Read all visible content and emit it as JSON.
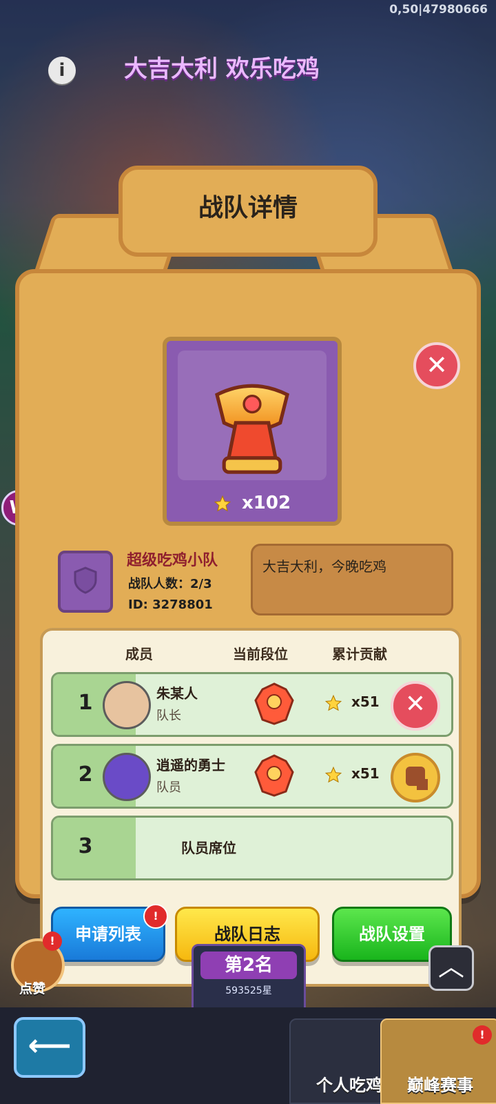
{
  "top_right_info": "0,50|47980666",
  "event_banner_title": "大吉大利 欢乐吃鸡",
  "modal": {
    "title": "战队详情",
    "banner_star_count": "x102",
    "team": {
      "name": "超级吃鸡小队",
      "count_label": "战队人数：2/3",
      "id_label": "ID: 3278801",
      "motto": "大吉大利，今晚吃鸡"
    },
    "table": {
      "headers": [
        "成员",
        "当前段位",
        "累计贡献"
      ],
      "rows": [
        {
          "index": "1",
          "name": "朱某人",
          "role": "队长",
          "contribution": "x51",
          "action_icon": "close-icon"
        },
        {
          "index": "2",
          "name": "逍遥的勇士",
          "role": "队员",
          "contribution": "x51",
          "action_icon": "boot-icon"
        },
        {
          "index": "3",
          "empty_label": "队员席位"
        }
      ]
    },
    "buttons": {
      "apply_list": "申请列表",
      "team_log": "战队日志",
      "team_settings": "战队设置"
    }
  },
  "bottom": {
    "like_label": "点赞",
    "rank_title": "第2名",
    "rank_stars": "593525星",
    "tabs": [
      "个人吃鸡",
      "巅峰赛事"
    ]
  },
  "icons": {
    "info": "info-icon",
    "close": "close-icon",
    "star": "star-icon",
    "shield": "shield-icon",
    "back": "back-arrow-icon",
    "up": "chevron-up-icon",
    "alert": "alert-icon"
  },
  "colors": {
    "panel_gold": "#e2ad56",
    "panel_border": "#c7873b",
    "banner_purple": "#8a5bb0",
    "red_button": "#e54d5d",
    "blue_button": "#197ad9",
    "yellow_button": "#f6b80f",
    "green_button": "#19b51c"
  }
}
